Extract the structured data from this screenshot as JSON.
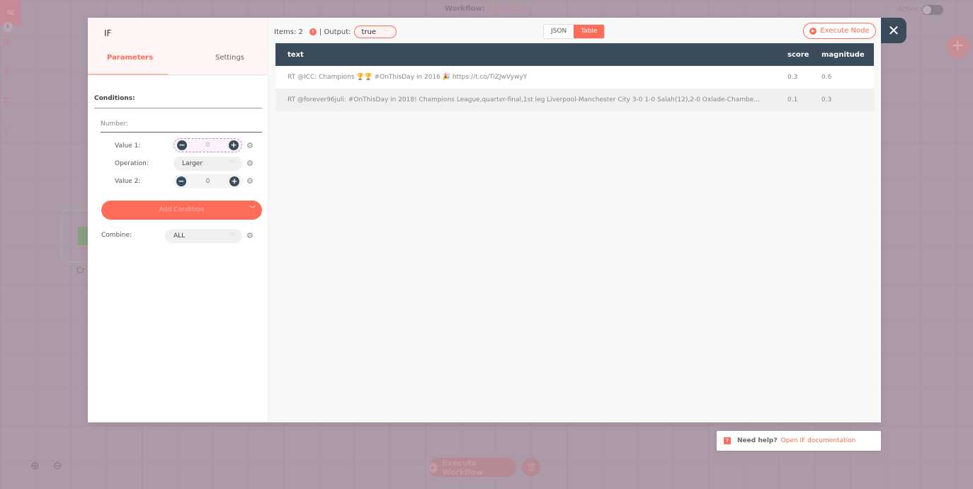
{
  "topbar": {
    "workflow_label": "Workflow:",
    "workflow_name": "ETL pipeline",
    "active_label": "Active:",
    "active": false
  },
  "sidebar": {
    "icons": [
      "workflow-logo-icon",
      "expand-chevron-icon",
      "nodes-icon",
      "key-icon",
      "list-icon",
      "help-icon"
    ]
  },
  "canvas": {
    "node_label": "Cr",
    "execute_workflow_label": "Execute Workflow"
  },
  "modal": {
    "node_title": "IF",
    "tabs": [
      {
        "label": "Parameters",
        "active": true
      },
      {
        "label": "Settings",
        "active": false
      }
    ],
    "conditions_label": "Conditions:",
    "number_label": "Number:",
    "value1_label": "Value 1:",
    "value1": "0",
    "operation_label": "Operation:",
    "operation": "Larger",
    "value2_label": "Value 2:",
    "value2": "0",
    "add_condition_label": "Add Condition",
    "combine_label": "Combine:",
    "combine_value": "ALL"
  },
  "output": {
    "items_label": "Items: 2",
    "info_icon": "!",
    "output_label": "| Output:",
    "output_value": "true",
    "view_json_label": "JSON",
    "view_table_label": "Table",
    "active_view": "Table",
    "execute_node_label": "Execute Node",
    "table": {
      "columns": [
        "text",
        "score",
        "magnitude"
      ],
      "rows": [
        {
          "text": "RT @ICC: Champions 🏆🏆 #OnThisDay in 2016 🎉 https://t.co/TiZJwVywyY",
          "score": "0.3",
          "magnitude": "0.6"
        },
        {
          "text": "RT @forever96juli: #OnThisDay in 2018! Champions League,quarter-final,1st leg Liverpool-Manchester City 3-0 1-0 Salah(12),2-0 Oxlade-Chambe...",
          "score": "0.1",
          "magnitude": "0.3"
        }
      ]
    }
  },
  "help": {
    "prefix": "Need help?",
    "link": "Open IF documentation"
  },
  "colors": {
    "accent": "#ff6d5a",
    "header_dark": "#3a4b5c",
    "overlay": "#ad9aa9"
  }
}
